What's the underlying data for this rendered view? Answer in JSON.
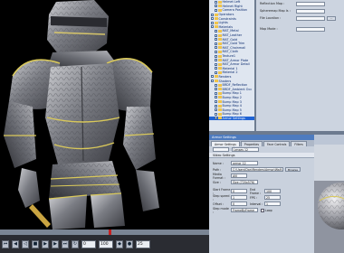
{
  "tree": {
    "items": [
      {
        "label": "Helmet Left",
        "selected": false
      },
      {
        "label": "Helmet Right",
        "selected": false
      },
      {
        "label": "Camera Position",
        "selected": false
      },
      {
        "label": "Operators",
        "selected": false
      },
      {
        "label": "Constraints",
        "selected": false
      },
      {
        "label": "Lights",
        "selected": false
      },
      {
        "label": "Materials",
        "selected": false
      },
      {
        "label": "MAT_Metal",
        "selected": false
      },
      {
        "label": "MAT_Leather",
        "selected": false
      },
      {
        "label": "MAT_Gold",
        "selected": false
      },
      {
        "label": "MAT_Gold Trim",
        "selected": false
      },
      {
        "label": "MAT_Chainmail",
        "selected": false
      },
      {
        "label": "MAT_Cloth",
        "selected": false
      },
      {
        "label": "Texture1",
        "selected": false
      },
      {
        "label": "MAT_Armor Plate",
        "selected": false
      },
      {
        "label": "MAT_Armor Detail",
        "selected": false
      },
      {
        "label": "Material 1",
        "selected": false
      },
      {
        "label": "Material 2",
        "selected": false
      },
      {
        "label": "Renders",
        "selected": false
      },
      {
        "label": "Shaders",
        "selected": false
      },
      {
        "label": "BRDF_Reflection",
        "selected": false
      },
      {
        "label": "BRDF_Ambient Occ",
        "selected": false
      },
      {
        "label": "Bump Map 1",
        "selected": false
      },
      {
        "label": "Bump Map 2",
        "selected": false
      },
      {
        "label": "Bump Map 3",
        "selected": false
      },
      {
        "label": "Bump Map 4",
        "selected": false
      },
      {
        "label": "Bump Map 5",
        "selected": false
      },
      {
        "label": "Bump Map 6",
        "selected": false
      },
      {
        "label": "Armor Settings",
        "selected": true
      }
    ]
  },
  "top_props": {
    "reflection_map_label": "Reflection Map :",
    "reflection_map_value": "",
    "sphere_map_label": "Spheremap Map Is :",
    "file_location_label": "File Location :",
    "file_location_value": "",
    "browse": "...",
    "map_mode_label": "Map Mode :",
    "map_mode_value": ""
  },
  "settings": {
    "title": "Armor Settings",
    "tabs": [
      "Armor Settings",
      "Properties",
      "Face Controls",
      "Filters"
    ],
    "active_tab": 0,
    "channel_label": "Lenses 12",
    "subhead": "Video Settings",
    "name_label": "Name :",
    "name_value": "armor 12",
    "path_label": "Path :",
    "path_value": "C:\\Users\\Dan\\Renders\\Armor\\Wall\\",
    "path_button": "Browse",
    "media_format_label": "Media Format :",
    "media_format_value": "AVI",
    "size_label": "Size :",
    "size_value": "Size (720x576)",
    "start_frame_label": "Start Frame :",
    "start_frame_value": "0",
    "end_frame_label": "End Frame :",
    "end_frame_value": "100",
    "step_label": "Step speed :",
    "step_value": "1",
    "fps_label": "FPS :",
    "fps_value": "25",
    "offset_label": "Offset :",
    "offset_value": "0",
    "interval_label": "Interval :",
    "interval_value": "1",
    "step_mode_label": "Step mode :",
    "step_mode_value": "FrameByFrame",
    "loop_label": "Loop"
  },
  "transport": {
    "frame_value": "0",
    "end_value": "100",
    "fps_value": "25"
  }
}
